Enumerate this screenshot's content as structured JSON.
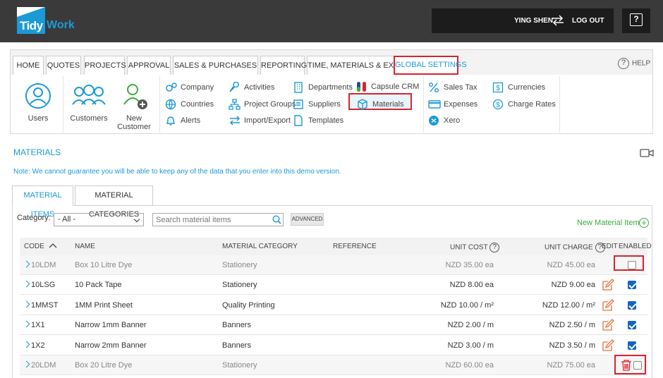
{
  "header": {
    "logo_text_1": "Tidy",
    "logo_text_2": "Work",
    "user": "YING SHEN",
    "logout": "LOG OUT",
    "help_glyph": "?"
  },
  "nav": {
    "tabs": [
      "HOME",
      "QUOTES",
      "PROJECTS",
      "APPROVAL",
      "SALES & PURCHASES",
      "REPORTING",
      "TIME, MATERIALS & EXPENSES",
      "GLOBAL SETTINGS"
    ],
    "active_tab": "GLOBAL SETTINGS",
    "help": "HELP"
  },
  "settings": {
    "users": "Users",
    "customers": "Customers",
    "new_customer_1": "New",
    "new_customer_2": "Customer",
    "col1": [
      "Company",
      "Countries",
      "Alerts"
    ],
    "col2": [
      "Activities",
      "Project Groups",
      "Import/Export"
    ],
    "col3": [
      "Departments",
      "Suppliers",
      "Templates"
    ],
    "col4": [
      "Capsule CRM",
      "Materials"
    ],
    "col5": [
      "Sales Tax",
      "Expenses",
      "Xero"
    ],
    "col6": [
      "Currencies",
      "Charge Rates"
    ]
  },
  "page": {
    "title": "MATERIALS",
    "note": "Note: We cannot guarantee you will be able to keep any of the data that you enter into this demo version.",
    "subtabs": [
      "MATERIAL ITEMS",
      "MATERIAL CATEGORIES"
    ]
  },
  "filters": {
    "category_label": "Category:",
    "category_value": "- All -",
    "search_placeholder": "Search material items",
    "advanced": "ADVANCED",
    "new_item": "New Material Item",
    "new_item_icon": "+"
  },
  "table": {
    "headers": {
      "code": "CODE",
      "name": "NAME",
      "category": "MATERIAL CATEGORY",
      "reference": "REFERENCE",
      "unit_cost": "UNIT COST",
      "unit_charge": "UNIT CHARGE",
      "edit": "EDIT",
      "enabled": "ENABLED"
    },
    "help_glyph": "?",
    "rows": [
      {
        "code": "10LDM",
        "name": "Box 10 Litre Dye",
        "category": "Stationery",
        "cost": "NZD 35.00 ea",
        "charge": "NZD 45.00 ea",
        "enabled": false,
        "editable": false
      },
      {
        "code": "10LSG",
        "name": "10 Pack Tape",
        "category": "Stationery",
        "cost": "NZD 8.00 ea",
        "charge": "NZD 9.00 ea",
        "enabled": true,
        "editable": true
      },
      {
        "code": "1MMST",
        "name": "1MM Print Sheet",
        "category": "Quality Printing",
        "cost": "NZD 10.00 / m²",
        "charge": "NZD 12.00 / m²",
        "enabled": true,
        "editable": true
      },
      {
        "code": "1X1",
        "name": "Narrow 1mm Banner",
        "category": "Banners",
        "cost": "NZD 2.00 / m",
        "charge": "NZD 2.50 / m",
        "enabled": true,
        "editable": true
      },
      {
        "code": "1X2",
        "name": "Narrow 2mm Banner",
        "category": "Banners",
        "cost": "NZD 3.00 / m",
        "charge": "NZD 3.50 / m",
        "enabled": true,
        "editable": true
      },
      {
        "code": "20LDM",
        "name": "Box 20 Litre Dye",
        "category": "Stationery",
        "cost": "NZD 60.00 ea",
        "charge": "NZD 75.00 ea",
        "enabled": false,
        "editable": false,
        "deletable": true
      }
    ]
  },
  "colors": {
    "accent": "#1c9ad6",
    "highlight": "#d9232e",
    "green": "#3dab3d",
    "topbar": "#3a3a3a"
  }
}
